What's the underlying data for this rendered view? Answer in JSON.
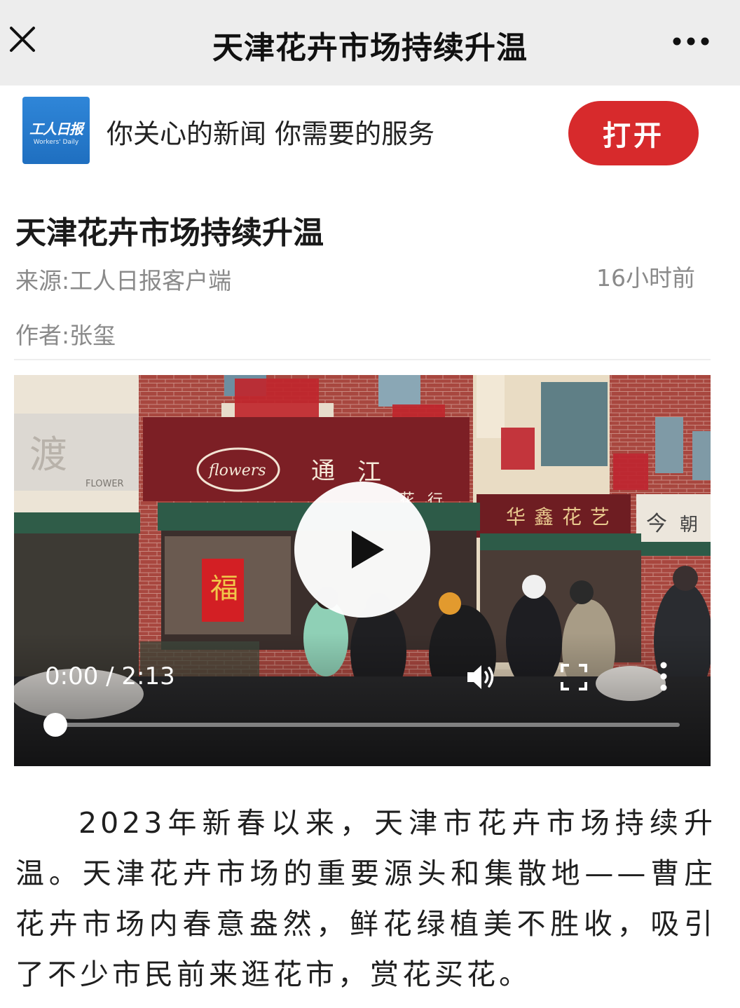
{
  "topbar": {
    "title": "天津花卉市场持续升温",
    "close_icon": "close-icon",
    "more_icon": "more-dots-icon"
  },
  "banner": {
    "logo_text": "工人日报",
    "logo_subtext": "Workers' Daily",
    "slogan": "你关心的新闻 你需要的服务",
    "open_label": "打开",
    "accent_color": "#d72a2c"
  },
  "article": {
    "title": "天津花卉市场持续升温",
    "source": "来源:工人日报客户端",
    "time": "16小时前",
    "author": "作者:张玺",
    "body": "2023年新春以来，天津市花卉市场持续升温。天津花卉市场的重要源头和集散地——曹庄花卉市场内春意盎然，鲜花绿植美不胜收，吸引了不少市民前来逛花市，赏花买花。"
  },
  "video": {
    "time_display": "0:00 / 2:13",
    "progress": 0,
    "storefront_signs": [
      "渡",
      "FLOWER",
      "flowers",
      "通",
      "江",
      "花",
      "行",
      "华",
      "鑫",
      "花",
      "艺",
      "今",
      "朝"
    ],
    "icons": [
      "play-icon",
      "volume-icon",
      "fullscreen-icon",
      "more-vertical-icon"
    ]
  }
}
